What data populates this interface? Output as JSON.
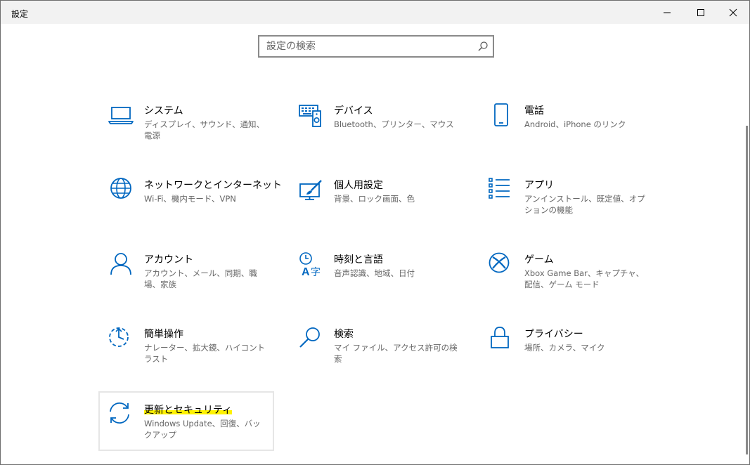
{
  "window": {
    "title": "設定",
    "minimize_icon": "minimize-icon",
    "maximize_icon": "maximize-icon",
    "close_icon": "close-icon"
  },
  "search": {
    "placeholder": "設定の検索",
    "icon": "search-icon"
  },
  "colors": {
    "accent": "#0067c0",
    "highlight": "#fff200",
    "subtext": "#666666",
    "titlebar": "#f2f2f2"
  },
  "tiles": [
    {
      "title": "システム",
      "subtitle": "ディスプレイ、サウンド、通知、電源",
      "icon": "laptop-icon"
    },
    {
      "title": "デバイス",
      "subtitle": "Bluetooth、プリンター、マウス",
      "icon": "keyboard-speaker-icon"
    },
    {
      "title": "電話",
      "subtitle": "Android、iPhone のリンク",
      "icon": "phone-icon"
    },
    {
      "title": "ネットワークとインターネット",
      "subtitle": "Wi-Fi、機内モード、VPN",
      "icon": "globe-icon"
    },
    {
      "title": "個人用設定",
      "subtitle": "背景、ロック画面、色",
      "icon": "paint-monitor-icon"
    },
    {
      "title": "アプリ",
      "subtitle": "アンインストール、既定値、オプションの機能",
      "icon": "app-list-icon"
    },
    {
      "title": "アカウント",
      "subtitle": "アカウント、メール、同期、職場、家族",
      "icon": "person-icon"
    },
    {
      "title": "時刻と言語",
      "subtitle": "音声認識、地域、日付",
      "icon": "time-language-icon"
    },
    {
      "title": "ゲーム",
      "subtitle": "Xbox Game Bar、キャプチャ、配信、ゲーム モード",
      "icon": "xbox-icon"
    },
    {
      "title": "簡単操作",
      "subtitle": "ナレーター、拡大鏡、ハイコントラスト",
      "icon": "ease-of-access-icon"
    },
    {
      "title": "検索",
      "subtitle": "マイ ファイル、アクセス許可の検索",
      "icon": "magnifier-icon"
    },
    {
      "title": "プライバシー",
      "subtitle": "場所、カメラ、マイク",
      "icon": "lock-icon"
    },
    {
      "title": "更新とセキュリティ",
      "subtitle": "Windows Update、回復、バックアップ",
      "icon": "sync-icon"
    }
  ]
}
